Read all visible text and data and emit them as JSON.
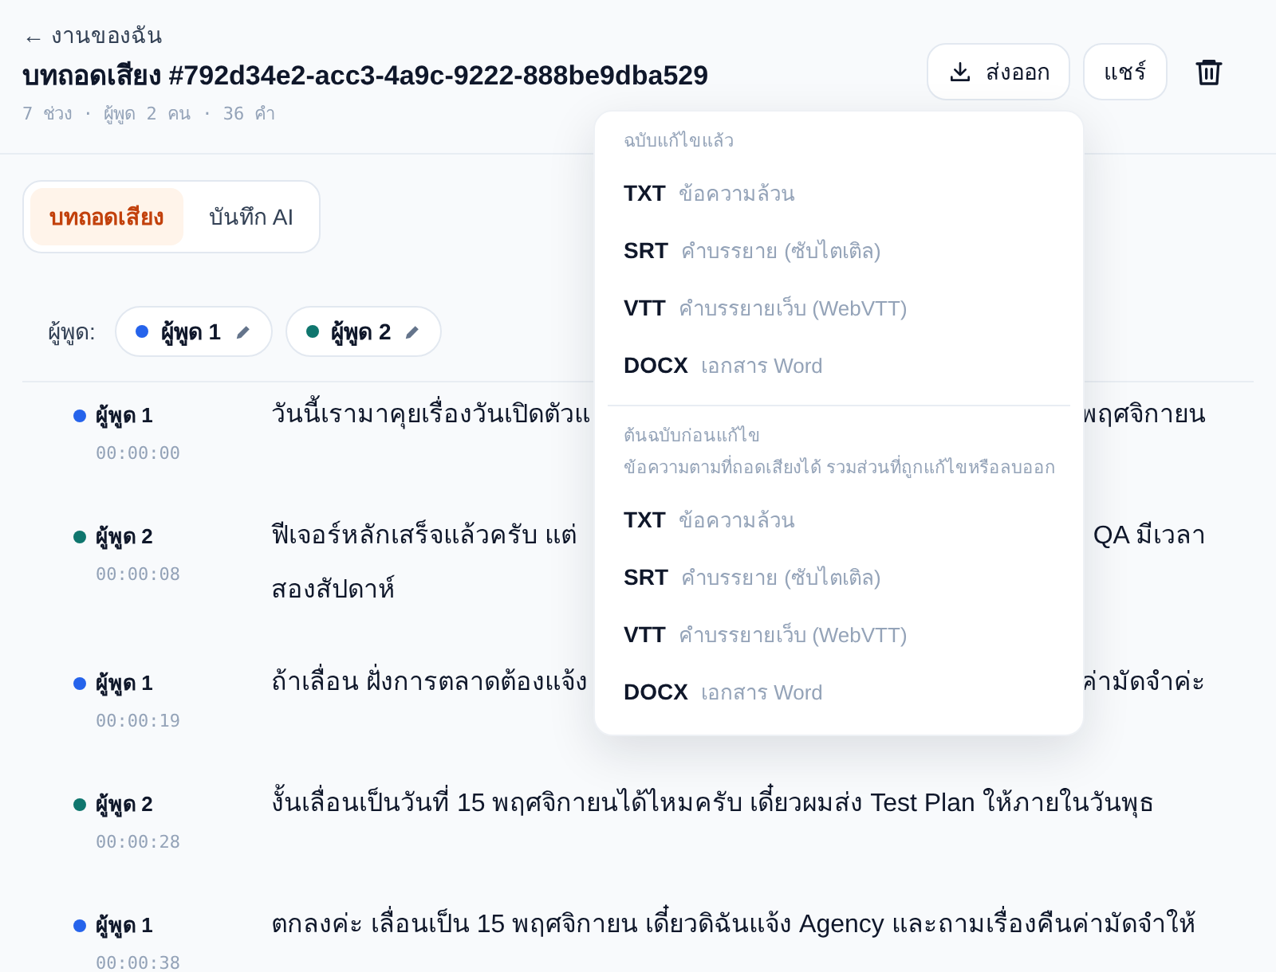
{
  "header": {
    "back_link": "← งานของฉัน",
    "title": "บทถอดเสียง #792d34e2-acc3-4a9c-9222-888be9dba529",
    "meta": "7 ช่วง · ผู้พูด 2 คน · 36 คำ",
    "buttons": [
      {
        "kind": "export",
        "label": "ส่งออก"
      },
      {
        "kind": "share",
        "label": "แชร์"
      },
      {
        "kind": "delete"
      }
    ]
  },
  "tabs": [
    {
      "label": "บทถอดเสียง",
      "selected": true
    },
    {
      "label": "บันทึก AI",
      "selected": false
    }
  ],
  "speakers": {
    "label": "ผู้พูด:",
    "items": [
      {
        "name": "ผู้พูด 1",
        "color": "#2563eb"
      },
      {
        "name": "ผู้พูด 2",
        "color": "#0f766e"
      }
    ]
  },
  "segments": [
    {
      "speaker": "ผู้พูด 1",
      "color": "#2563eb",
      "time": "00:00:00",
      "lines": [
        {
          "text": "วันนี้เรามาคุยเรื่องวันเปิดตัวแ",
          "text_right": "พฤศจิกายน"
        }
      ]
    },
    {
      "speaker": "ผู้พูด 2",
      "color": "#0f766e",
      "time": "00:00:08",
      "lines": [
        {
          "text": "ฟีเจอร์หลักเสร็จแล้วครับ แต่",
          "text_right": "QA มีเวลา"
        },
        {
          "text": "สองสัปดาห์"
        }
      ]
    },
    {
      "speaker": "ผู้พูด 1",
      "color": "#2563eb",
      "time": "00:00:19",
      "lines": [
        {
          "text": "ถ้าเลื่อน ฝั่งการตลาดต้องแจ้ง",
          "text_right": "ค่ามัดจำค่ะ"
        }
      ]
    },
    {
      "speaker": "ผู้พูด 2",
      "color": "#0f766e",
      "time": "00:00:28",
      "lines": [
        {
          "text": "งั้นเลื่อนเป็นวันที่ 15 พฤศจิกายนได้ไหมครับ เดี๋ยวผมส่ง Test Plan ให้ภายในวันพุธ"
        }
      ]
    },
    {
      "speaker": "ผู้พูด 1",
      "color": "#2563eb",
      "time": "00:00:38",
      "lines": [
        {
          "text": "ตกลงค่ะ เลื่อนเป็น 15 พฤศจิกายน เดี๋ยวดิฉันแจ้ง Agency และถามเรื่องคืนค่ามัดจำให้"
        }
      ]
    }
  ],
  "export_menu": {
    "sections": [
      {
        "title": "ฉบับแก้ไขแล้ว",
        "items": [
          {
            "format": "TXT",
            "description": "ข้อความล้วน"
          },
          {
            "format": "SRT",
            "description": "คำบรรยาย (ซับไตเติล)"
          },
          {
            "format": "VTT",
            "description": "คำบรรยายเว็บ (WebVTT)"
          },
          {
            "format": "DOCX",
            "description": "เอกสาร Word"
          }
        ]
      },
      {
        "title": "ต้นฉบับก่อนแก้ไข",
        "subtitle": "ข้อความตามที่ถอดเสียงได้ รวมส่วนที่ถูกแก้ไขหรือลบออก",
        "items": [
          {
            "format": "TXT",
            "description": "ข้อความล้วน"
          },
          {
            "format": "SRT",
            "description": "คำบรรยาย (ซับไตเติล)"
          },
          {
            "format": "VTT",
            "description": "คำบรรยายเว็บ (WebVTT)"
          },
          {
            "format": "DOCX",
            "description": "เอกสาร Word"
          }
        ]
      }
    ]
  }
}
